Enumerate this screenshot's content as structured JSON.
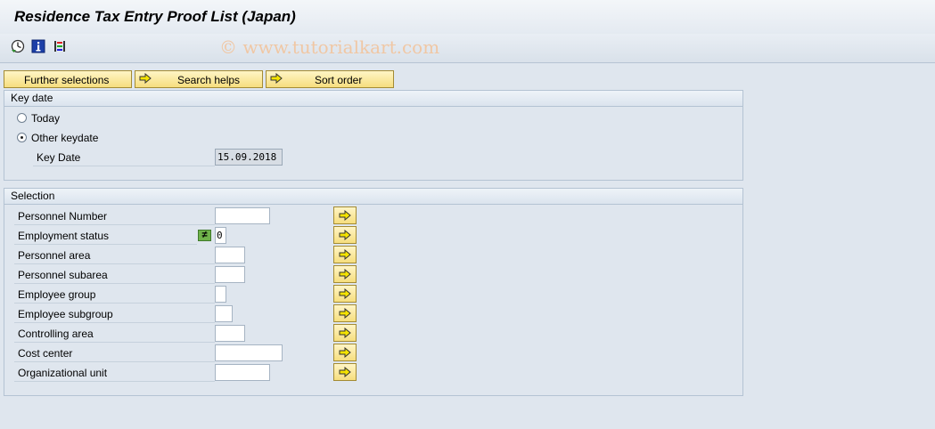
{
  "window": {
    "title": "Residence Tax Entry Proof List (Japan)"
  },
  "toolbar": {
    "icons": [
      "execute-icon",
      "info-icon",
      "variant-icon"
    ],
    "watermark": "© www.tutorialkart.com"
  },
  "selection_buttons": [
    {
      "label": "Further selections"
    },
    {
      "label": "Search helps"
    },
    {
      "label": "Sort order"
    }
  ],
  "key_date_group": {
    "title": "Key date",
    "today_label": "Today",
    "other_keydate_label": "Other keydate",
    "selected": "other_keydate",
    "key_date_label": "Key Date",
    "key_date_value": "15.09.2018"
  },
  "selection_group": {
    "title": "Selection",
    "rows": [
      {
        "label": "Personnel Number",
        "value": ""
      },
      {
        "label": "Employment status",
        "value": "0",
        "operator": "≠"
      },
      {
        "label": "Personnel area",
        "value": ""
      },
      {
        "label": "Personnel subarea",
        "value": ""
      },
      {
        "label": "Employee group",
        "value": ""
      },
      {
        "label": "Employee subgroup",
        "value": ""
      },
      {
        "label": "Controlling area",
        "value": ""
      },
      {
        "label": "Cost center",
        "value": ""
      },
      {
        "label": "Organizational unit",
        "value": ""
      }
    ]
  },
  "colors": {
    "background": "#dfe6ee",
    "button": "#f6de7e",
    "arrow": "#f5e300",
    "operator_icon": "#6fb24a"
  }
}
